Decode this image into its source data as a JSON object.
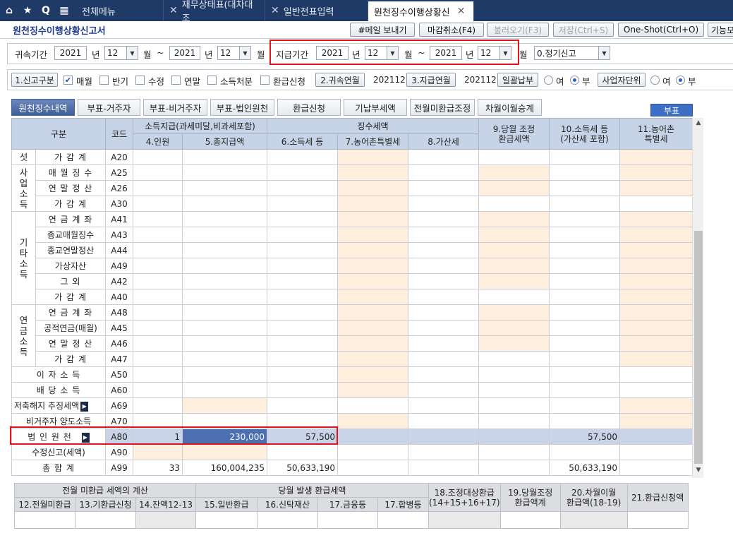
{
  "topbar": {
    "tabs": [
      {
        "label": "전체메뉴"
      },
      {
        "label": "재무상태표(대차대조"
      },
      {
        "label": "일반전표입력"
      },
      {
        "label": "원천징수이행상황신"
      }
    ]
  },
  "page_title": "원천징수이행상황신고서",
  "toolbar": {
    "email": "#메일 보내기",
    "close_cancel": "마감취소(F4)",
    "load": "불러오기(F3)",
    "save": "저장(Ctrl+S)",
    "oneshot": "One-Shot(Ctrl+O)",
    "func": "기능모"
  },
  "period": {
    "label": "귀속기간",
    "from_year": "2021",
    "from_month": "12",
    "to_year": "2021",
    "to_month": "12",
    "year_unit": "년",
    "month_unit": "월",
    "tilde": "~"
  },
  "pay_period": {
    "label": "지급기간",
    "from_year": "2021",
    "from_month": "12",
    "to_year": "2021",
    "to_month": "12"
  },
  "report_type": {
    "trailing": "월",
    "value": "0.정기신고"
  },
  "row2": {
    "report_div": "1.신고구분",
    "monthly": "매월",
    "half": "반기",
    "amend": "수정",
    "yearend": "연말",
    "income_disp": "소득처분",
    "refund_apply": "환급신청",
    "attrib_ym_btn": "2.귀속연월",
    "attrib_ym": "202112",
    "pay_ym_btn": "3.지급연월",
    "pay_ym": "202112",
    "lump_btn": "일괄납부",
    "yes": "여",
    "no": "부",
    "biz_unit_btn": "사업자단위",
    "yes2": "여",
    "no2": "부"
  },
  "subtabs": [
    "원천징수내역",
    "부표-거주자",
    "부표-비거주자",
    "부표-법인원천",
    "환급신청",
    "기납부세액",
    "전월미환급조정",
    "차월이월승계"
  ],
  "bupyo": "부표",
  "grid": {
    "h_gubun": "구분",
    "h_code": "코드",
    "h_income": "소득지급(과세미달,비과세포함)",
    "h_tax": "징수세액",
    "h_people": "4.인원",
    "h_total": "5.총지급액",
    "h_income_tax": "6.소득세 등",
    "h_rural": "7.농어촌특별세",
    "h_add": "8.가산세",
    "h9": "9.당월 조정\n환급세액",
    "h10": "10.소득세 등\n(가산세 포함)",
    "h11": "11.농어촌\n특별세",
    "g1": "섯",
    "g2": "사업소득",
    "g3": "기타소득",
    "g4": "연금소득",
    "rows": [
      {
        "label": "가 감 계",
        "code": "A20"
      },
      {
        "label": "매 월 징 수",
        "code": "A25"
      },
      {
        "label": "연 말 정 산",
        "code": "A26"
      },
      {
        "label": "가 감 계",
        "code": "A30"
      },
      {
        "label": "연 금 계 좌",
        "code": "A41"
      },
      {
        "label": "종교매월징수",
        "code": "A43"
      },
      {
        "label": "종교연말정산",
        "code": "A44"
      },
      {
        "label": "가상자산",
        "code": "A49"
      },
      {
        "label": "그 외",
        "code": "A42"
      },
      {
        "label": "가 감 계",
        "code": "A40"
      },
      {
        "label": "연 금 계 좌",
        "code": "A48"
      },
      {
        "label": "공적연금(매월)",
        "code": "A45"
      },
      {
        "label": "연 말 정 산",
        "code": "A46"
      },
      {
        "label": "가 감 계",
        "code": "A47"
      },
      {
        "label": "이 자 소 득",
        "code": "A50"
      },
      {
        "label": "배 당 소 득",
        "code": "A60"
      },
      {
        "label": "저축해지 추징세액",
        "code": "A69"
      },
      {
        "label": "비거주자 양도소득",
        "code": "A70"
      },
      {
        "label": "법 인 원 천",
        "code": "A80",
        "people": "1",
        "total": "230,000",
        "tax": "57,500",
        "tax10": "57,500"
      },
      {
        "label": "수정신고(세액)",
        "code": "A90"
      },
      {
        "label": "총 합 계",
        "code": "A99",
        "people": "33",
        "total": "160,004,235",
        "tax": "50,633,190",
        "tax10": "50,633,190"
      }
    ]
  },
  "bottom": {
    "h_prev": "전월 미환급 세액의 계산",
    "h_cur": "당월 발생 환급세액",
    "h18": "18.조정대상환급\n(14+15+16+17)",
    "h19": "19.당월조정\n환급액계",
    "h20": "20.차월이월\n환급액(18-19)",
    "h21": "21.환급신청액",
    "c12": "12.전월미환급",
    "c13": "13.기환급신청",
    "c14": "14.잔액12-13",
    "c15": "15.일반환급",
    "c16": "16.신탁재산",
    "c17": "17.금융등",
    "c17b": "17.합병등"
  }
}
